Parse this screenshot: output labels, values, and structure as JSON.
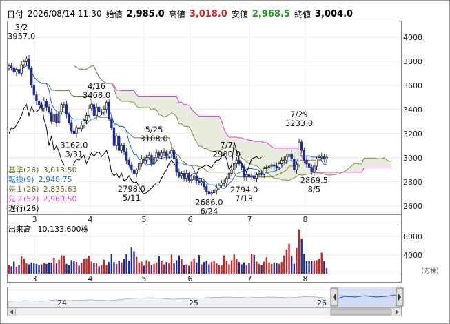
{
  "header": {
    "date_label": "日付",
    "date_value": "2026/08/14 11:30",
    "open_label": "始値",
    "open_value": "2,985.0",
    "high_label": "高値",
    "high_value": "3,018.0",
    "low_label": "安値",
    "low_value": "2,968.5",
    "close_label": "終値",
    "close_value": "3,004.0"
  },
  "colors": {
    "up": "#1a1a1a",
    "down": "#1a2a9a",
    "kijun": "#7a7a2a",
    "tenkan": "#1e6ed8",
    "senkou1": "#8a8a3a",
    "senkou2": "#e040e0",
    "chikou": "#000000",
    "cloud": "#e6eadc",
    "volume_up": "#cc2222",
    "volume_down": "#1a2a9a"
  },
  "legend": [
    {
      "label": "基準(26)",
      "value": "3,013.50",
      "color": "#6a6a20"
    },
    {
      "label": "転換(9)",
      "value": "2,948.75",
      "color": "#1e6ed8"
    },
    {
      "label": "先１(26)",
      "value": "2,835.63",
      "color": "#6a6a20"
    },
    {
      "label": "先２(52)",
      "value": "2,960.50",
      "color": "#e040e0"
    },
    {
      "label": "遅行(26)",
      "value": "",
      "color": "#000000"
    }
  ],
  "volume_label": "出来高",
  "volume_value": "10,133,600株",
  "volume_unit": "（万株）",
  "navigator": {
    "labels": [
      "24",
      "25",
      "26"
    ]
  },
  "chart_data": {
    "type": "candlestick",
    "price_axis": {
      "ticks": [
        "4000",
        "3800",
        "3600",
        "3400",
        "3200",
        "3000",
        "2800",
        "2600"
      ],
      "ylim": [
        2530,
        4130
      ]
    },
    "volume_axis": {
      "ticks": [
        "8000",
        "4000"
      ],
      "ylim": [
        0,
        10500
      ]
    },
    "month_ticks": [
      "3",
      "4",
      "5",
      "6",
      "7",
      "8"
    ],
    "annotations": [
      {
        "date": "3/2",
        "value": "3957.0"
      },
      {
        "date": "3/31",
        "value": "3162.0"
      },
      {
        "date": "4/16",
        "value": "3468.0"
      },
      {
        "date": "5/11",
        "value": "2798.0"
      },
      {
        "date": "5/25",
        "value": "3108.0"
      },
      {
        "date": "6/24",
        "value": "2686.0"
      },
      {
        "date": "7/7",
        "value": "2980.0"
      },
      {
        "date": "7/13",
        "value": "2794.0"
      },
      {
        "date": "7/29",
        "value": "3233.0"
      },
      {
        "date": "8/5",
        "value": "2869.5"
      }
    ],
    "closes": [
      3760,
      3745,
      3710,
      3730,
      3700,
      3770,
      3795,
      3820,
      3740,
      3600,
      3520,
      3470,
      3440,
      3410,
      3470,
      3420,
      3380,
      3300,
      3360,
      3290,
      3380,
      3440,
      3440,
      3360,
      3290,
      3220,
      3200,
      3250,
      3240,
      3270,
      3310,
      3350,
      3410,
      3440,
      3350,
      3420,
      3380,
      3380,
      3400,
      3460,
      3320,
      3250,
      3100,
      3180,
      3060,
      3100,
      3050,
      2980,
      2940,
      2900,
      2870,
      2900,
      2950,
      2990,
      2980,
      3000,
      3020,
      2950,
      3000,
      3040,
      3010,
      3040,
      3050,
      3010,
      3030,
      3060,
      2990,
      2880,
      2850,
      2870,
      2830,
      2870,
      2810,
      2820,
      2850,
      2810,
      2790,
      2800,
      2760,
      2720,
      2700,
      2710,
      2730,
      2750,
      2770,
      2790,
      2790,
      2830,
      2870,
      2900,
      2950,
      2980,
      2950,
      2920,
      2840,
      2860,
      2840,
      2850,
      2830,
      2860,
      2870,
      2860,
      2910,
      2920,
      2930,
      2940,
      2930,
      2920,
      2950,
      2980,
      2980,
      3010,
      3030,
      2990,
      2900,
      2940,
      3130,
      3060,
      2980,
      2950,
      2920,
      2880,
      2930,
      2990,
      3000,
      3010,
      2990,
      3004
    ],
    "volumes": [
      1800,
      1600,
      2600,
      1500,
      1900,
      3700,
      3300,
      2200,
      2000,
      2400,
      2200,
      2100,
      1900,
      2000,
      2300,
      2100,
      2400,
      2400,
      3400,
      2200,
      3000,
      3900,
      3800,
      2100,
      1800,
      2900,
      2800,
      2500,
      1700,
      2300,
      3200,
      3300,
      3800,
      2600,
      2300,
      2200,
      1600,
      1900,
      3000,
      1800,
      2500,
      4300,
      2500,
      2100,
      2800,
      2400,
      3100,
      4200,
      2800,
      5600,
      4800,
      3600,
      2300,
      2600,
      1700,
      2900,
      2600,
      1900,
      2100,
      2400,
      3700,
      2800,
      2000,
      2500,
      2200,
      4100,
      2200,
      2900,
      3900,
      3100,
      1800,
      2000,
      1700,
      2600,
      3300,
      2400,
      4000,
      2000,
      2500,
      2800,
      2000,
      2500,
      2700,
      2200,
      1900,
      1800,
      3900,
      2800,
      2000,
      2900,
      4100,
      3100,
      2500,
      2000,
      2400,
      1800,
      2300,
      4300,
      4000,
      2600,
      2100,
      1900,
      2600,
      3500,
      2400,
      2100,
      2400,
      2300,
      2100,
      2500,
      3900,
      5200,
      6400,
      3800,
      2100,
      5500,
      9500,
      7500,
      4300,
      2700,
      2800,
      2800,
      2800,
      2900,
      3200,
      4500,
      2700,
      1200
    ]
  }
}
